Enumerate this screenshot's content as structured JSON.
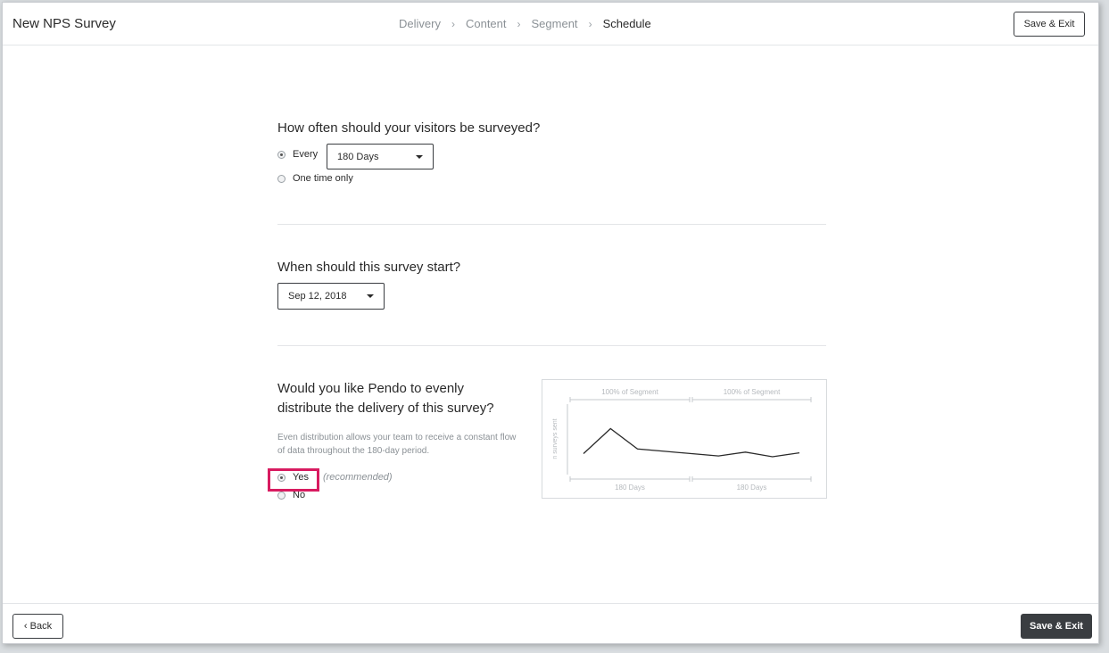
{
  "header": {
    "title": "New NPS Survey",
    "steps": [
      {
        "label": "Delivery"
      },
      {
        "label": "Content"
      },
      {
        "label": "Segment"
      },
      {
        "label": "Schedule"
      }
    ],
    "separator": "›",
    "save_exit_label": "Save & Exit"
  },
  "frequency": {
    "question": "How often should your visitors be surveyed?",
    "every_label": "Every",
    "every_selected": true,
    "interval_value": "180 Days",
    "one_time_label": "One time only"
  },
  "start": {
    "question": "When should this survey start?",
    "date_value": "Sep 12, 2018"
  },
  "distribution": {
    "question_line1": "Would you like Pendo to evenly",
    "question_line2": "distribute the delivery of this survey?",
    "description": "Even distribution allows your team to receive a constant flow of data throughout the 180-day period.",
    "yes_label": "Yes",
    "yes_selected": true,
    "recommended_label": "(recommended)",
    "no_label": "No"
  },
  "chart_data": {
    "type": "line",
    "ylabel": "n surveys sent",
    "top_labels": [
      "100% of Segment",
      "100% of Segment"
    ],
    "bottom_labels": [
      "180 Days",
      "180 Days"
    ],
    "series": [
      {
        "values": [
          1.0,
          2.6,
          1.3,
          1.15,
          1.0,
          0.85,
          1.1,
          0.8,
          1.05
        ]
      }
    ],
    "ylim": [
      0,
      4
    ]
  },
  "footer": {
    "back_label": "‹ Back",
    "save_exit_label": "Save & Exit"
  },
  "colors": {
    "accent_dark": "#3a3d41",
    "highlight": "#d81b60"
  }
}
